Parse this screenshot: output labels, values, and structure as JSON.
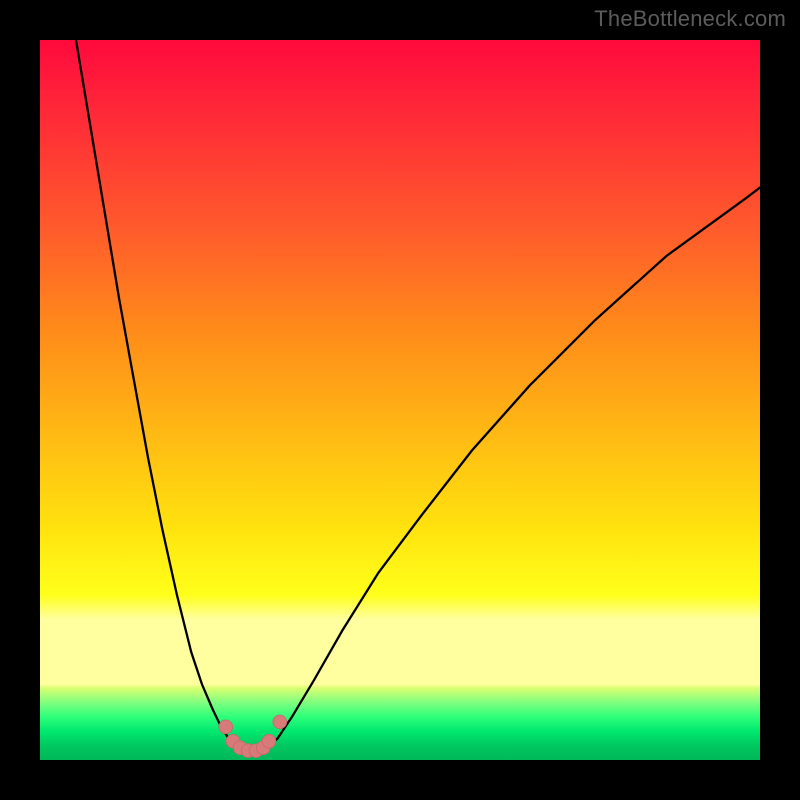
{
  "watermark": "TheBottleneck.com",
  "colors": {
    "frame": "#000000",
    "curve": "#000000",
    "dot_fill": "#d97a7a",
    "dot_stroke": "#c96a6a"
  },
  "chart_data": {
    "type": "line",
    "title": "",
    "xlabel": "",
    "ylabel": "",
    "note": "No axes, ticks, or labels are rendered in the image. x-axis read as 0–100 across plot width; y-axis read as 0 (bottom) to 100 (top). Values are estimates from pixel positions.",
    "xlim": [
      0,
      100
    ],
    "ylim": [
      0,
      100
    ],
    "series": [
      {
        "name": "left-branch",
        "description": "Steep descending curve entering from top-left, terminating near the dot cluster at bottom.",
        "x": [
          5,
          7,
          9,
          11,
          13,
          15,
          17,
          19,
          21,
          22.5,
          24,
          25.2,
          26.2,
          27,
          27.6
        ],
        "y": [
          100,
          88,
          76,
          64,
          53,
          42,
          32,
          23,
          15,
          10.5,
          7,
          4.5,
          3,
          2,
          1.6
        ]
      },
      {
        "name": "right-branch",
        "description": "Curve rising from the dot cluster, concave, exiting near upper-right.",
        "x": [
          31.5,
          33,
          35,
          38,
          42,
          47,
          53,
          60,
          68,
          77,
          87,
          98,
          100
        ],
        "y": [
          1.6,
          3,
          6,
          11,
          18,
          26,
          34,
          43,
          52,
          61,
          70,
          78,
          79.5
        ]
      }
    ],
    "scatter": {
      "name": "bottom-dot-cluster",
      "description": "Pink/salmon filled circular markers clustered at the curve minimum.",
      "color": "#d97a7a",
      "points": [
        {
          "x": 25.8,
          "y": 4.6
        },
        {
          "x": 26.8,
          "y": 2.6
        },
        {
          "x": 27.8,
          "y": 1.7
        },
        {
          "x": 28.9,
          "y": 1.3
        },
        {
          "x": 30.0,
          "y": 1.3
        },
        {
          "x": 31.0,
          "y": 1.7
        },
        {
          "x": 31.8,
          "y": 2.6
        },
        {
          "x": 33.3,
          "y": 5.3
        }
      ]
    },
    "background_gradient_stops": [
      {
        "pct": 0,
        "color": "#ff0a3c"
      },
      {
        "pct": 26,
        "color": "#ff5a2c"
      },
      {
        "pct": 54,
        "color": "#ffb714"
      },
      {
        "pct": 77,
        "color": "#ffff1a"
      },
      {
        "pct": 85,
        "color": "#ffffa0"
      },
      {
        "pct": 92,
        "color": "#80ff80"
      },
      {
        "pct": 100,
        "color": "#00b858"
      }
    ]
  }
}
